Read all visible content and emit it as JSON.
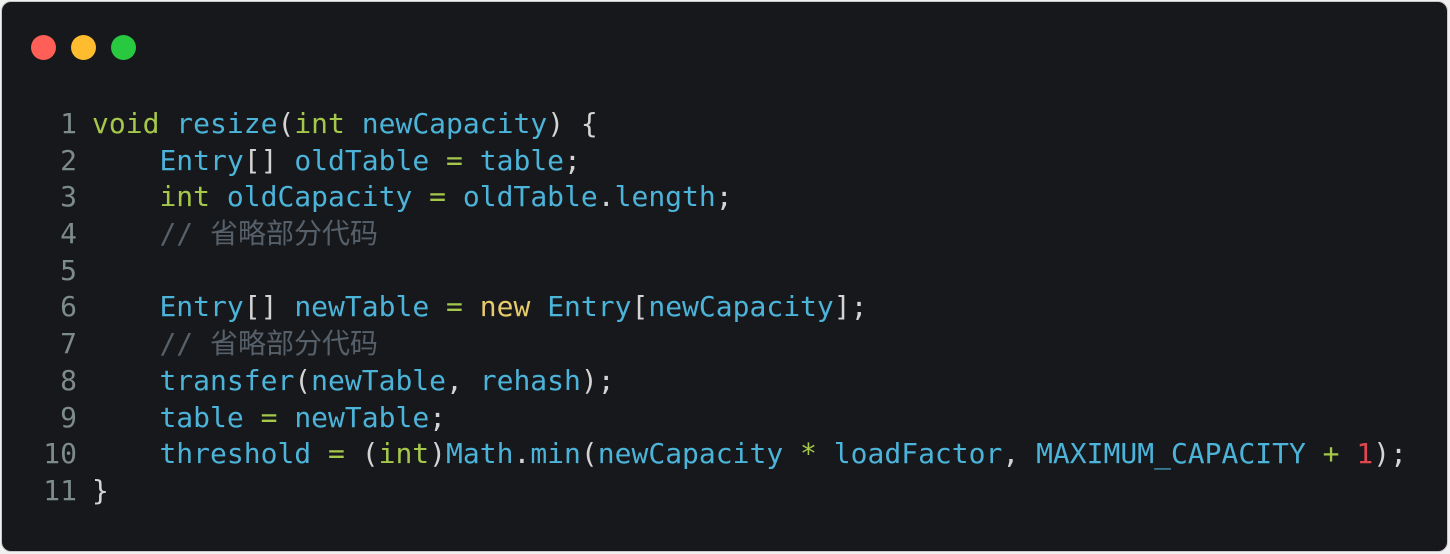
{
  "window": {
    "buttons": {
      "close": "#ff5f57",
      "minimize": "#febc2e",
      "maximize": "#28c840"
    }
  },
  "code": {
    "lines": [
      {
        "n": "1",
        "tokens": [
          [
            "void",
            "kw"
          ],
          [
            " ",
            "pl"
          ],
          [
            "resize",
            "id"
          ],
          [
            "(",
            "pl"
          ],
          [
            "int",
            "kw"
          ],
          [
            " ",
            "pl"
          ],
          [
            "newCapacity",
            "id"
          ],
          [
            ") {",
            "pl"
          ]
        ]
      },
      {
        "n": "2",
        "tokens": [
          [
            "    ",
            "pl"
          ],
          [
            "Entry",
            "id"
          ],
          [
            "[] ",
            "pl"
          ],
          [
            "oldTable",
            "id"
          ],
          [
            " = ",
            "kw"
          ],
          [
            "table",
            "id"
          ],
          [
            ";",
            "pl"
          ]
        ]
      },
      {
        "n": "3",
        "tokens": [
          [
            "    ",
            "pl"
          ],
          [
            "int",
            "kw"
          ],
          [
            " ",
            "pl"
          ],
          [
            "oldCapacity",
            "id"
          ],
          [
            " = ",
            "kw"
          ],
          [
            "oldTable",
            "id"
          ],
          [
            ".",
            "pl"
          ],
          [
            "length",
            "id"
          ],
          [
            ";",
            "pl"
          ]
        ]
      },
      {
        "n": "4",
        "tokens": [
          [
            "    ",
            "pl"
          ],
          [
            "// 省略部分代码",
            "cm"
          ]
        ]
      },
      {
        "n": "5",
        "tokens": []
      },
      {
        "n": "6",
        "tokens": [
          [
            "    ",
            "pl"
          ],
          [
            "Entry",
            "id"
          ],
          [
            "[] ",
            "pl"
          ],
          [
            "newTable",
            "id"
          ],
          [
            " = ",
            "kw"
          ],
          [
            "new",
            "nw"
          ],
          [
            " ",
            "pl"
          ],
          [
            "Entry",
            "id"
          ],
          [
            "[",
            "pl"
          ],
          [
            "newCapacity",
            "id"
          ],
          [
            "];",
            "pl"
          ]
        ]
      },
      {
        "n": "7",
        "tokens": [
          [
            "    ",
            "pl"
          ],
          [
            "// 省略部分代码",
            "cm"
          ]
        ]
      },
      {
        "n": "8",
        "tokens": [
          [
            "    ",
            "pl"
          ],
          [
            "transfer",
            "id"
          ],
          [
            "(",
            "pl"
          ],
          [
            "newTable",
            "id"
          ],
          [
            ", ",
            "pl"
          ],
          [
            "rehash",
            "id"
          ],
          [
            ");",
            "pl"
          ]
        ]
      },
      {
        "n": "9",
        "tokens": [
          [
            "    ",
            "pl"
          ],
          [
            "table",
            "id"
          ],
          [
            " = ",
            "kw"
          ],
          [
            "newTable",
            "id"
          ],
          [
            ";",
            "pl"
          ]
        ]
      },
      {
        "n": "10",
        "tokens": [
          [
            "    ",
            "pl"
          ],
          [
            "threshold",
            "id"
          ],
          [
            " = ",
            "kw"
          ],
          [
            "(",
            "pl"
          ],
          [
            "int",
            "kw"
          ],
          [
            ")",
            "pl"
          ],
          [
            "Math",
            "id"
          ],
          [
            ".",
            "pl"
          ],
          [
            "min",
            "id"
          ],
          [
            "(",
            "pl"
          ],
          [
            "newCapacity",
            "id"
          ],
          [
            " * ",
            "kw"
          ],
          [
            "loadFactor",
            "id"
          ],
          [
            ", ",
            "pl"
          ],
          [
            "MAXIMUM_CAPACITY",
            "id"
          ],
          [
            " + ",
            "kw"
          ],
          [
            "1",
            "num"
          ],
          [
            ");",
            "pl"
          ]
        ]
      },
      {
        "n": "11",
        "tokens": [
          [
            "}",
            "pl"
          ]
        ]
      }
    ]
  }
}
